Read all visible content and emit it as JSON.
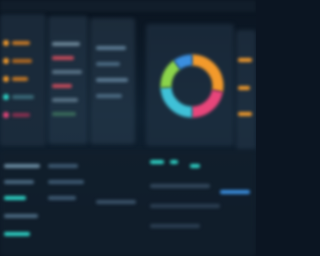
{
  "dashboard": {
    "donut": {
      "segments": [
        {
          "color": "#f39a2b",
          "fraction": 0.28
        },
        {
          "color": "#e8457a",
          "fraction": 0.22
        },
        {
          "color": "#3fc1d8",
          "fraction": 0.24
        },
        {
          "color": "#8bd44a",
          "fraction": 0.16
        },
        {
          "color": "#3a8fe0",
          "fraction": 0.1
        }
      ]
    },
    "colors": {
      "background": "#0b1522",
      "panel": "#2a3c4e",
      "accent_orange": "#f39a2b",
      "accent_teal": "#2ed3c6",
      "accent_blue": "#3a8fe0",
      "accent_red": "#e8457a",
      "accent_green": "#8bd44a"
    }
  }
}
